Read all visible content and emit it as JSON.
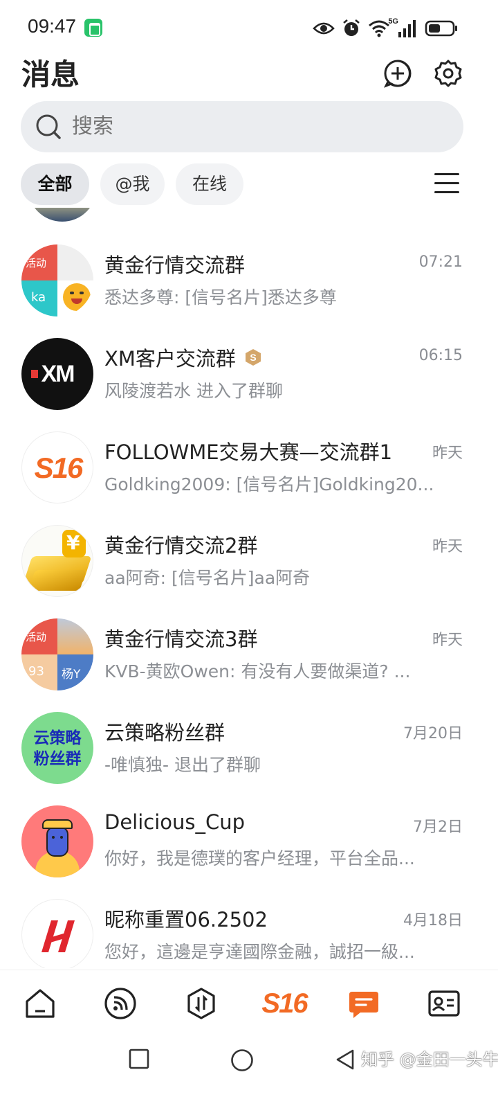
{
  "status_bar": {
    "time": "09:47",
    "network": "5G"
  },
  "header": {
    "title": "消息"
  },
  "search": {
    "placeholder": "搜索"
  },
  "filters": [
    {
      "label": "全部",
      "active": true
    },
    {
      "label": "@我",
      "active": false
    },
    {
      "label": "在线",
      "active": false
    }
  ],
  "conversations": [
    {
      "name": "黄金行情交流群",
      "time": "07:21",
      "preview": "悉达多尊: [信号名片]悉达多尊"
    },
    {
      "name": "XM客户交流群",
      "time": "06:15",
      "preview": "风陵渡若水  进入了群聊"
    },
    {
      "name": "FOLLOWME交易大赛—交流群1",
      "time": "昨天",
      "preview": "Goldking2009: [信号名片]Goldking20..."
    },
    {
      "name": "黄金行情交流2群",
      "time": "昨天",
      "preview": "aa阿奇: [信号名片]aa阿奇"
    },
    {
      "name": "黄金行情交流3群",
      "time": "昨天",
      "preview": "KVB-黄欧Owen: 有没有人要做渠道? ..."
    },
    {
      "name": "云策略粉丝群",
      "time": "7月20日",
      "preview": "-唯慎独-  退出了群聊"
    },
    {
      "name": "Delicious_Cup",
      "time": "7月2日",
      "preview": "你好，我是德璞的客户经理，平台全品..."
    },
    {
      "name": "昵称重置06.2502",
      "time": "4月18日",
      "preview": "您好，這邊是亨達國際金融，誠招一級..."
    }
  ],
  "avatars": {
    "group1_tag": "活动",
    "group1_ka": "ka",
    "xm": "XM",
    "s16": "S16",
    "group3_tag": "活动",
    "group3_num": "93",
    "group3_name": "杨Y",
    "yunce_line1": "云策略",
    "yunce_line2": "粉丝群"
  },
  "bottom_nav": {
    "items": [
      "home-icon",
      "feed-icon",
      "trade-icon",
      "s16-logo",
      "messages-icon",
      "contacts-icon"
    ],
    "logo_text": "S16",
    "accent": "#f26a24"
  },
  "watermark": "知乎 @金田一头牛"
}
